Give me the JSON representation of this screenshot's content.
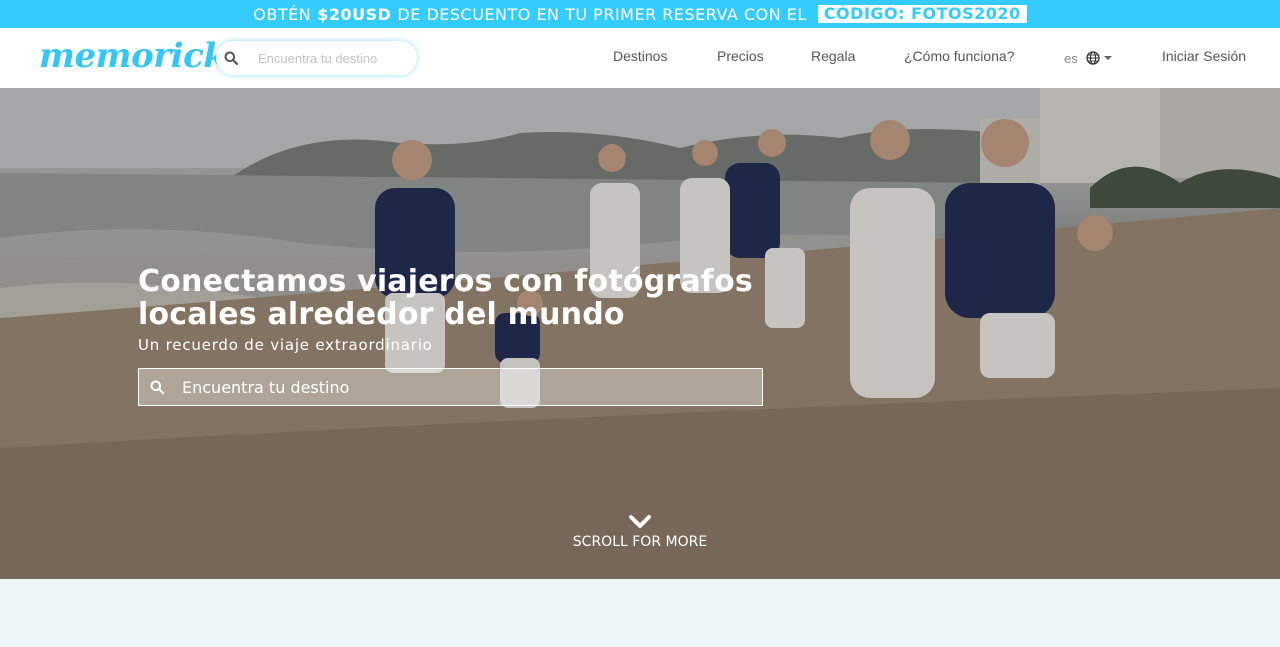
{
  "promo": {
    "prefix": "OBTÉN",
    "amount": "$20USD",
    "middle": "DE DESCUENTO EN TU PRIMER RESERVA CON EL",
    "code": "CÓDIGO: FOTOS2020"
  },
  "header": {
    "logo": "memorick",
    "search_placeholder": "Encuentra tu destino",
    "nav": [
      "Destinos",
      "Precios",
      "Regala",
      "¿Cómo funciona?"
    ],
    "lang": "es",
    "login": "Iniciar Sesión"
  },
  "hero": {
    "title": "Conectamos viajeros con fotógrafos locales alrededor del mundo",
    "subtitle": "Un recuerdo de viaje extraordinario",
    "search_placeholder": "Encuentra tu destino",
    "scroll_label": "SCROLL FOR MORE"
  },
  "colors": {
    "brand": "#34cbff",
    "header_bg": "#ffffff",
    "page_bg": "#eef5f8"
  },
  "icons": {
    "search": "search-icon",
    "language": "globe-icon",
    "dropdown": "caret-down-icon",
    "scroll": "chevron-down-icon"
  }
}
